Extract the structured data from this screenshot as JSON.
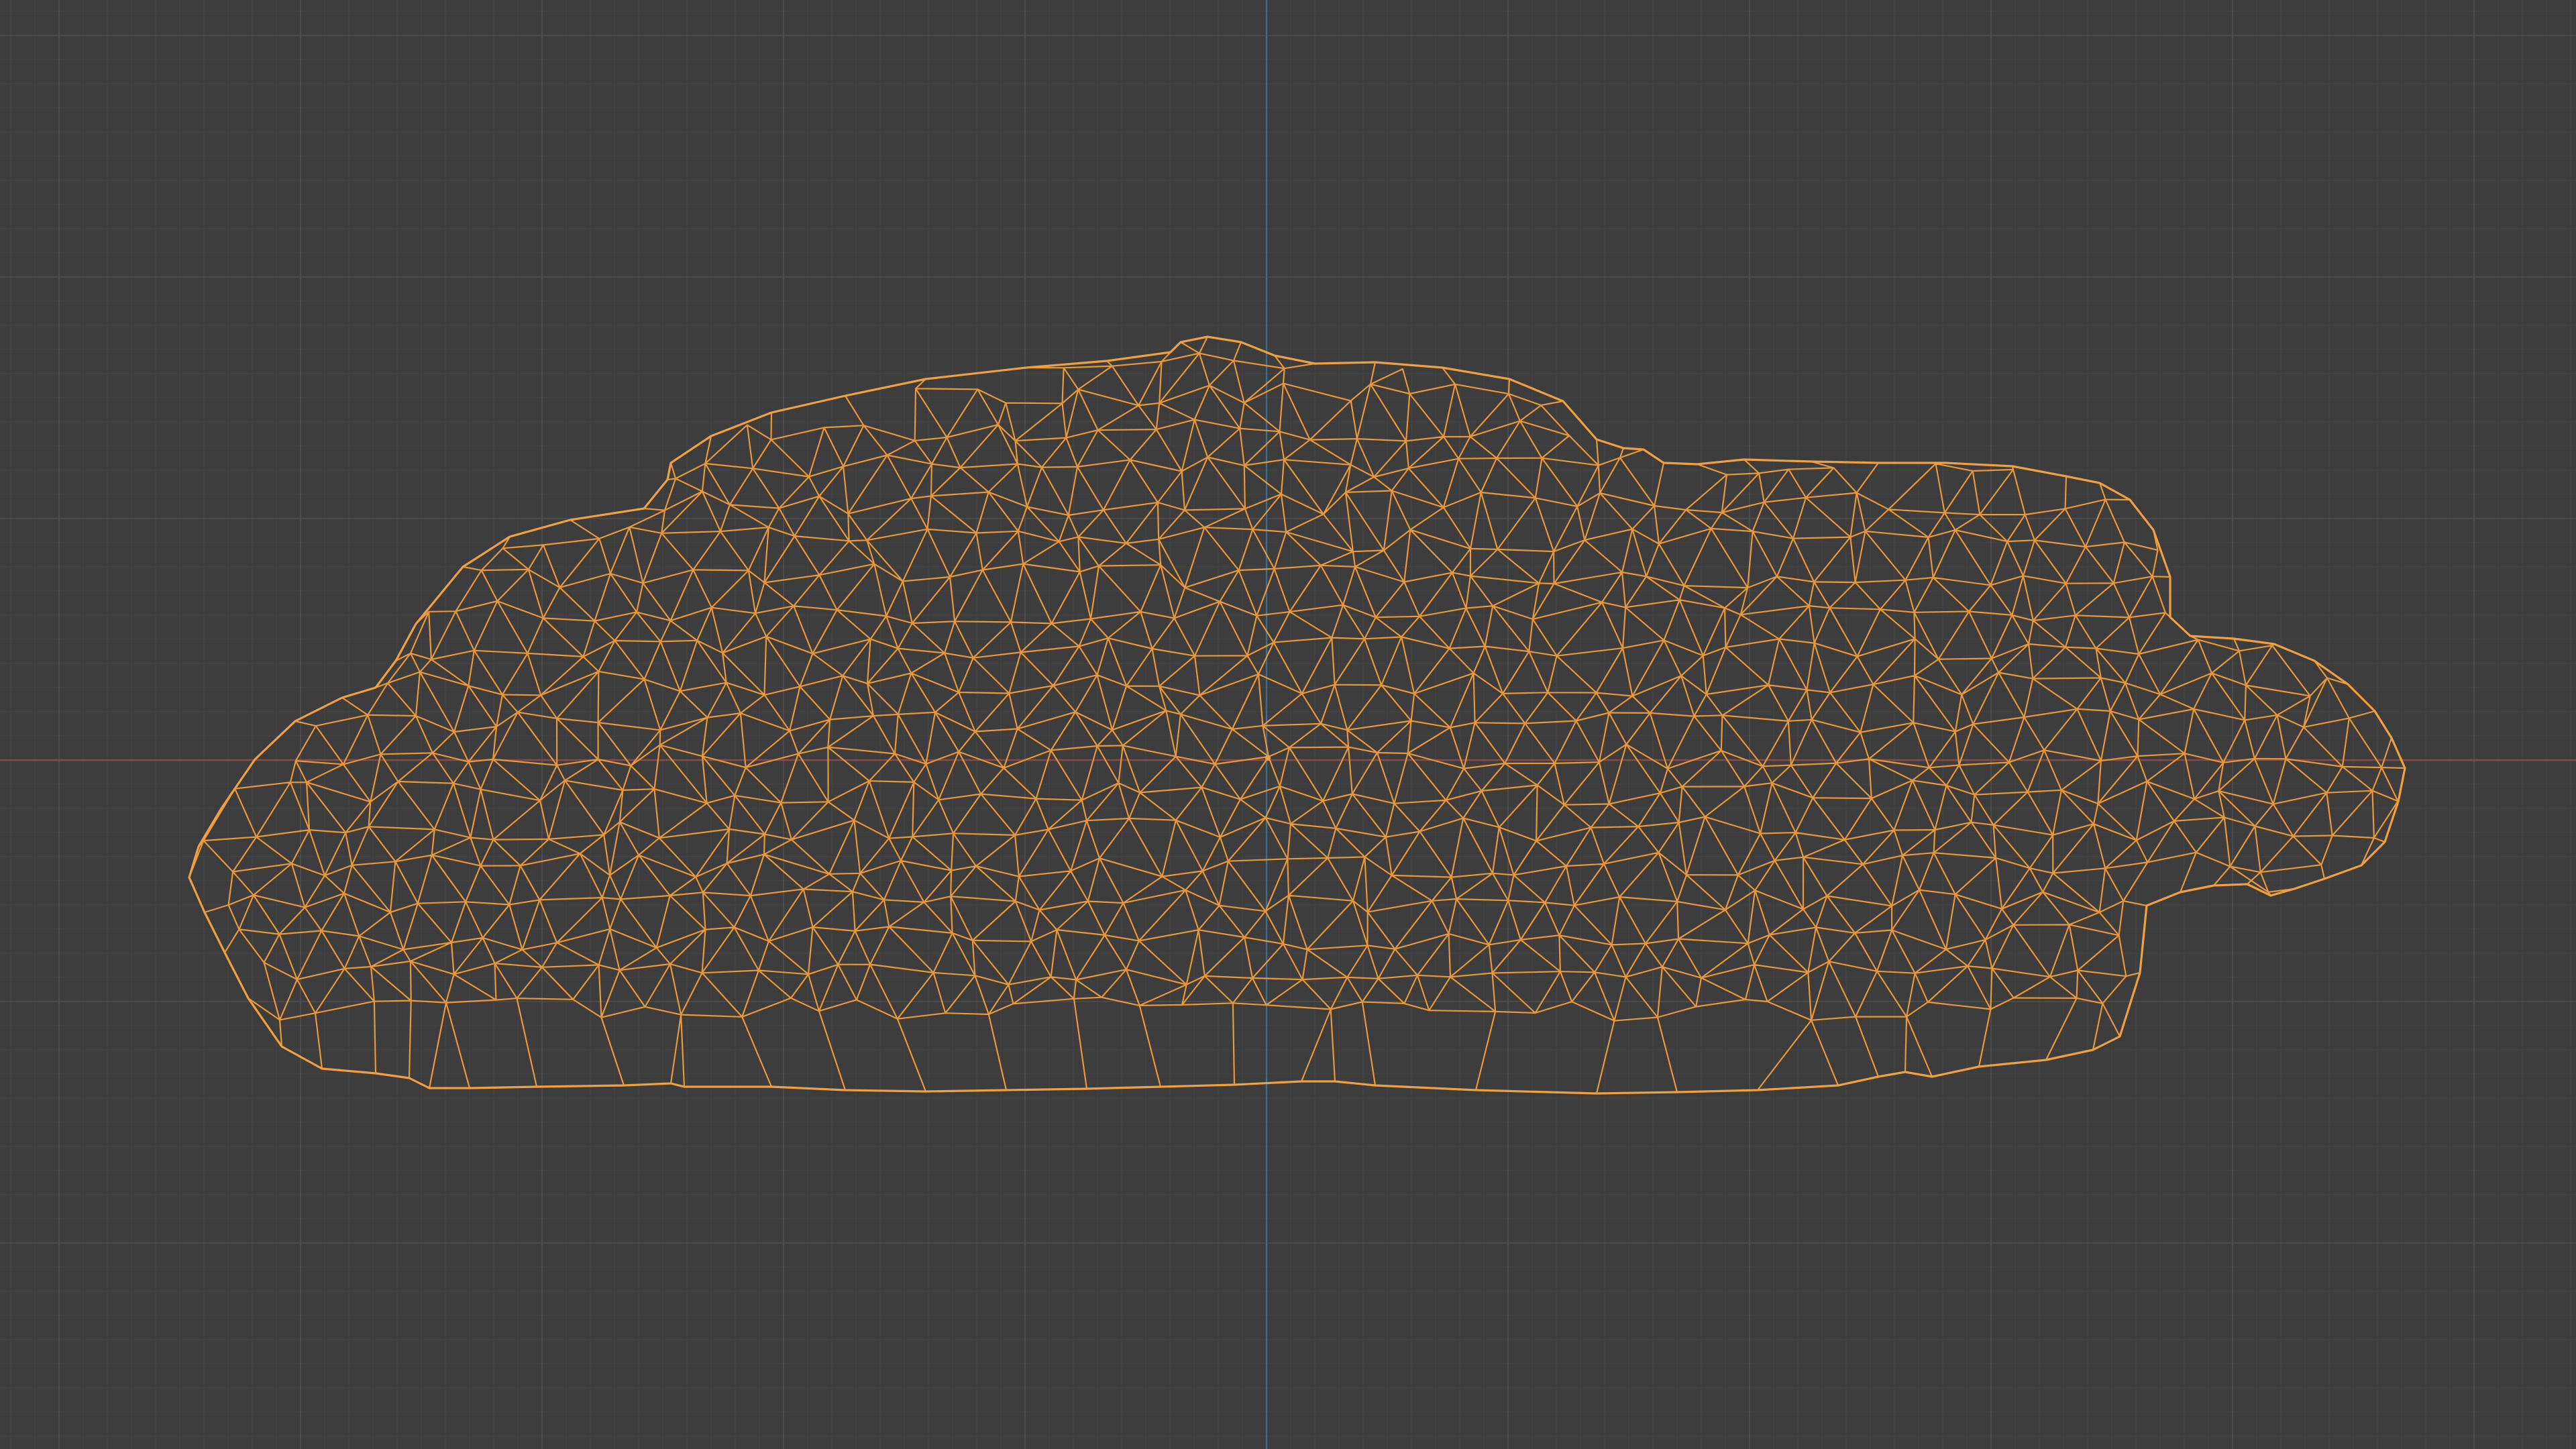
{
  "viewport": {
    "mode": "wireframe",
    "view": "orthographic-front",
    "show_grid": true,
    "show_axes": true
  },
  "colors": {
    "background": "#3d3d3d",
    "grid_minor": "#444444",
    "grid_major": "#4a4a4a",
    "axis_x": "#8a4a4a",
    "axis_z": "#3f6c8a",
    "wire": "#e8973a",
    "wire_outline": "#f0a040"
  },
  "object": {
    "type": "mesh",
    "selected": true,
    "origin_marker": true
  }
}
